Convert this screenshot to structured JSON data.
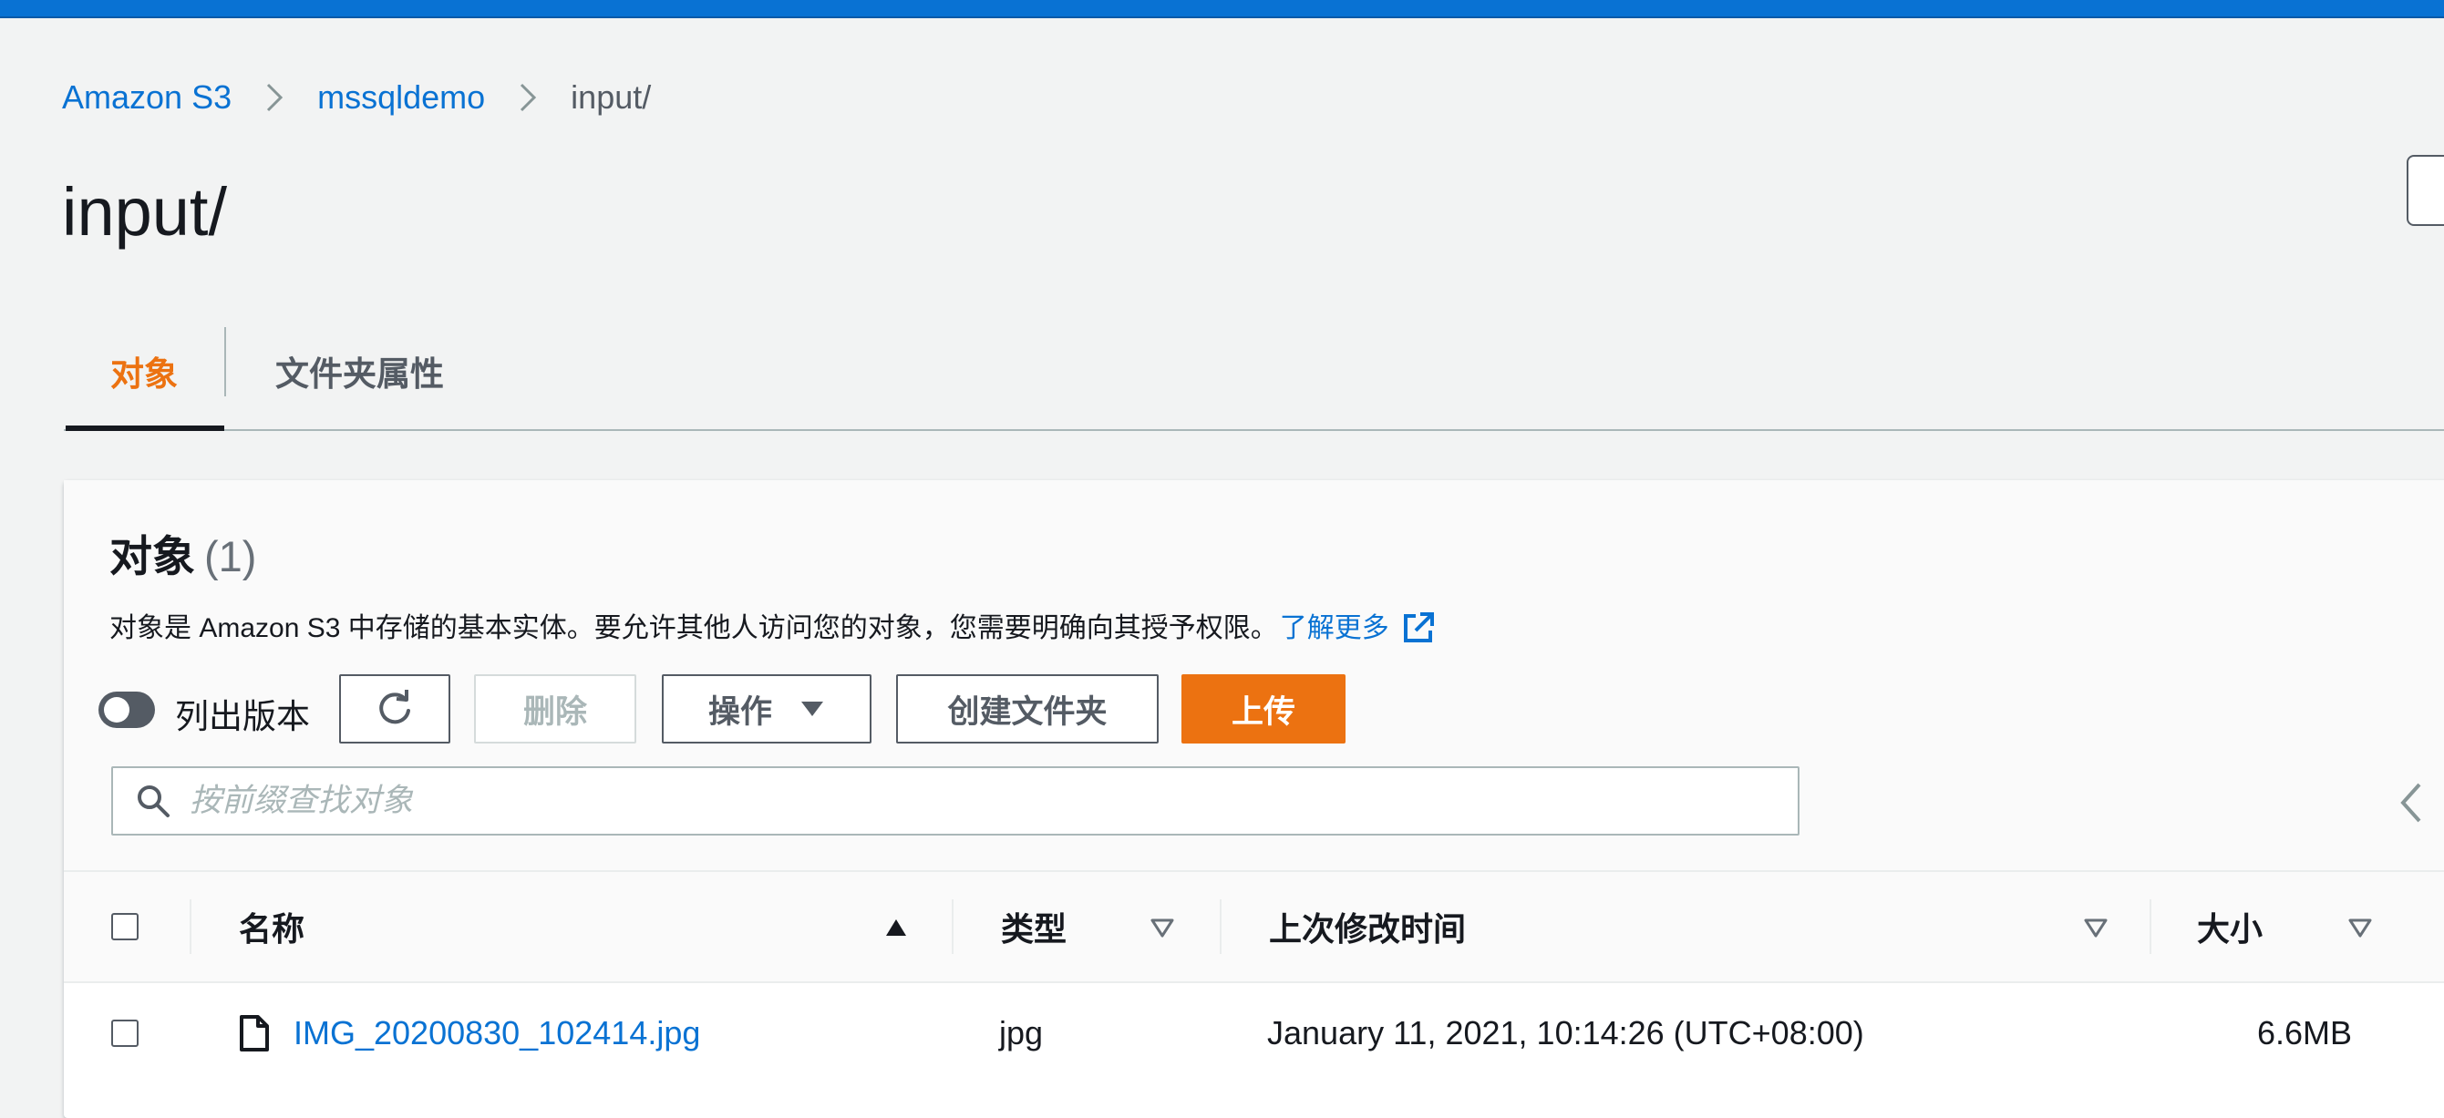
{
  "breadcrumb": {
    "items": [
      {
        "label": "Amazon S3"
      },
      {
        "label": "mssqldemo"
      },
      {
        "label": "input/"
      }
    ]
  },
  "page": {
    "title": "input/"
  },
  "tabs": [
    {
      "label": "对象",
      "active": true
    },
    {
      "label": "文件夹属性",
      "active": false
    }
  ],
  "panel": {
    "title": "对象",
    "count": "(1)",
    "description": "对象是 Amazon S3 中存储的基本实体。要允许其他人访问您的对象，您需要明确向其授予权限。",
    "learn_more": "了解更多"
  },
  "toolbar": {
    "toggle_label": "列出版本",
    "toggle_on": false,
    "delete_label": "删除",
    "actions_label": "操作",
    "create_folder_label": "创建文件夹",
    "upload_label": "上传"
  },
  "search": {
    "placeholder": "按前缀查找对象",
    "value": ""
  },
  "table": {
    "columns": [
      {
        "label": "名称",
        "sort": "ascending"
      },
      {
        "label": "类型",
        "sort": "none"
      },
      {
        "label": "上次修改时间",
        "sort": "none"
      },
      {
        "label": "大小",
        "sort": "none"
      }
    ],
    "rows": [
      {
        "name": "IMG_20200830_102414.jpg",
        "type": "jpg",
        "last_modified": "January 11, 2021, 10:14:26 (UTC+08:00)",
        "size": "6.6MB"
      }
    ]
  },
  "colors": {
    "accent": "#0972d3",
    "primary_button": "#ec7211",
    "active_tab": "#ec7211",
    "text": "#16191f",
    "muted": "#545b64",
    "background": "#f2f3f3"
  },
  "icons": {
    "breadcrumb_separator": "chevron-right-icon",
    "refresh": "refresh-icon",
    "actions_caret": "caret-down-icon",
    "search": "search-icon",
    "external_link": "external-link-icon",
    "file": "file-icon",
    "pager_previous": "chevron-left-icon"
  }
}
